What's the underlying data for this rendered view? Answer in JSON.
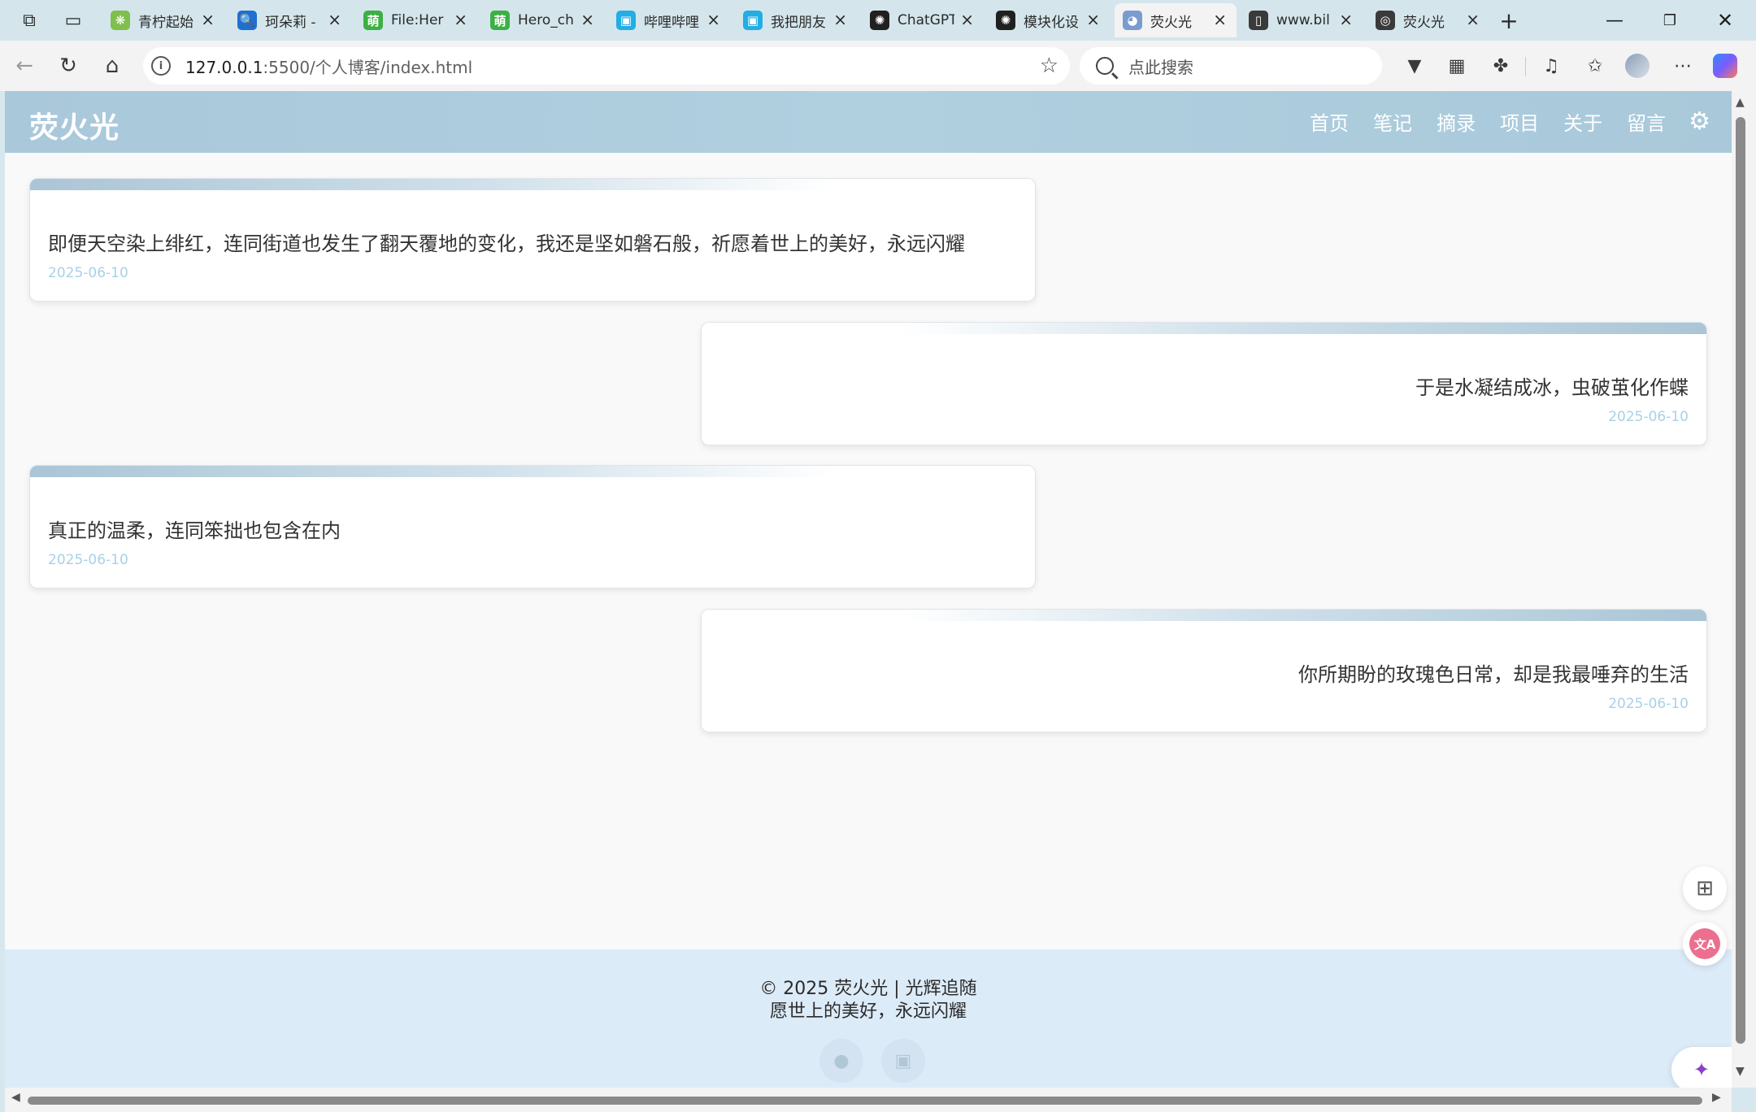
{
  "browser": {
    "tabs": [
      {
        "title": "青柠起始",
        "icon": "lime-icon",
        "color": "#7fbf4d",
        "glyph": "❋"
      },
      {
        "title": "珂朵莉 -",
        "icon": "search-icon",
        "color": "#1f6fd1",
        "glyph": "🔍"
      },
      {
        "title": "File:Her",
        "icon": "moe-wiki-icon",
        "color": "#3cb043",
        "glyph": "萌"
      },
      {
        "title": "Hero_ch",
        "icon": "moe-wiki-icon",
        "color": "#3cb043",
        "glyph": "萌"
      },
      {
        "title": "哔哩哔哩",
        "icon": "bilibili-icon",
        "color": "#23ade5",
        "glyph": "▣"
      },
      {
        "title": "我把朋友",
        "icon": "bilibili-icon",
        "color": "#23ade5",
        "glyph": "▣"
      },
      {
        "title": "ChatGPT",
        "icon": "openai-icon",
        "color": "#202020",
        "glyph": "✺"
      },
      {
        "title": "模块化设",
        "icon": "openai-icon",
        "color": "#202020",
        "glyph": "✺"
      },
      {
        "title": "荧火光",
        "icon": "anime-avatar-icon",
        "color": "#7a9bd0",
        "glyph": "◕"
      },
      {
        "title": "www.bil",
        "icon": "page-error-icon",
        "color": "#3a3a3a",
        "glyph": "▯"
      },
      {
        "title": "荧火光",
        "icon": "globe-icon",
        "color": "#3a3a3a",
        "glyph": "◎"
      }
    ],
    "active_tab": 8,
    "url_host": "127.0.0.1",
    "url_path": ":5500/个人博客/index.html",
    "search_placeholder": "点此搜索"
  },
  "site": {
    "title": "荧火光",
    "nav": [
      "首页",
      "笔记",
      "摘录",
      "项目",
      "关于",
      "留言"
    ]
  },
  "notes": [
    {
      "text": "即便天空染上绯红，连同街道也发生了翻天覆地的变化，我还是坚如磐石般，祈愿着世上的美好，永远闪耀",
      "date": "2025-06-10",
      "align": "left"
    },
    {
      "text": "于是水凝结成冰，虫破茧化作蝶",
      "date": "2025-06-10",
      "align": "right"
    },
    {
      "text": "真正的温柔，连同笨拙也包含在内",
      "date": "2025-06-10",
      "align": "left"
    },
    {
      "text": "你所期盼的玫瑰色日常，却是我最唾弃的生活",
      "date": "2025-06-10",
      "align": "right"
    }
  ],
  "footer": {
    "copyright": "© 2025 荧火光 | 光辉追随",
    "motto": "愿世上的美好，永远闪耀"
  },
  "colors": {
    "header": "#abc9db",
    "footer": "#dcebf8",
    "date": "#a8d1e6"
  }
}
